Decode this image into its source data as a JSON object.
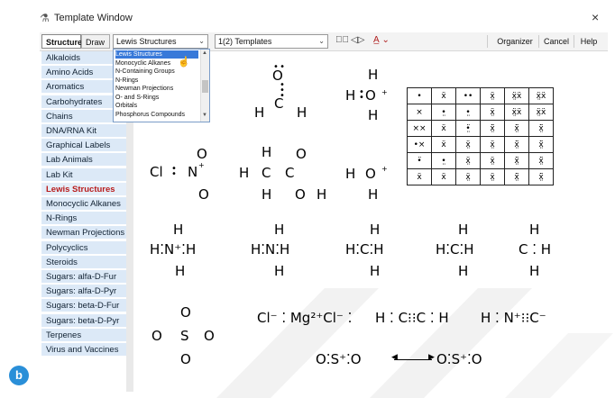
{
  "window": {
    "title": "Template Window",
    "close": "×"
  },
  "toolbar": {
    "tab_structure": "Structure",
    "tab_draw": "Draw",
    "category_select": "Lewis Structures",
    "template_select": "1(2) Templates",
    "organizer": "Organizer",
    "cancel": "Cancel",
    "help": "Help"
  },
  "dropdown": {
    "items": [
      "Lewis Structures",
      "Monocyclic Alkanes",
      "N-Containing Groups",
      "N-Rings",
      "Newman Projections",
      "O- and S-Rings",
      "Orbitals",
      "Phosphorus Compounds"
    ],
    "highlighted_index": 0
  },
  "sidebar": {
    "items": [
      "Alkaloids",
      "Amino Acids",
      "Aromatics",
      "Carbohydrates",
      "Chains",
      "DNA/RNA Kit",
      "Graphical Labels",
      "Lab Animals",
      "Lab Kit",
      "Lewis Structures",
      "Monocyclic Alkanes",
      "N-Rings",
      "Newman Projections",
      "Polycyclics",
      "Steroids",
      "Sugars: alfa-D-Fur",
      "Sugars: alfa-D-Pyr",
      "Sugars: beta-D-Fur",
      "Sugars: beta-D-Pyr",
      "Terpenes",
      "Virus and Vaccines"
    ],
    "selected_index": 9
  },
  "canvas": {
    "labels": {
      "water_o": "O",
      "water_h1": "H",
      "water_c": "C",
      "water_h2": "H",
      "hydronium_h": "H",
      "hydronium_left": "H",
      "hydronium_o": "O",
      "hydronium_plus": "+",
      "hydronium_bottom": "H",
      "nitrate_cl": "Cl",
      "nitrate_n": "N",
      "nitrate_plus": "+",
      "nitrate_o1": "O",
      "nitrate_o2": "O",
      "acid_h1": "H",
      "acid_h2": "H",
      "acid_c1": "C",
      "acid_c2": "C",
      "acid_o1": "O",
      "acid_o2": "O",
      "acid_h3": "H",
      "acid_h4": "H",
      "hyd2_left": "H",
      "hyd2_o": "O",
      "hyd2_plus": "+",
      "hyd2_bottom": "H",
      "ammonium": "H⁚N⁺⁚H",
      "methane_n": "H⁚N⁚H",
      "methane_c": "H⁚C⁚H",
      "methyl_c": "H⁚C⁚H",
      "radical_c": "C",
      "sulfate_s": "S",
      "mgcl2": "Cl⁻ ⁚ Mg²⁺Cl⁻ ⁚",
      "acetylene": "H ⁚ C⁝⁝C ⁚ H",
      "hcn": "H ⁚ N⁺⁝⁝C⁻",
      "so2_left": "O⁚S⁺⁚O",
      "so2_right": "O⁚S⁺⁚O"
    },
    "dot_table": [
      [
        "•",
        "ẍ",
        "••",
        "ẍ̤",
        "ẍ̤ẍ",
        "ẍ̤ẍ"
      ],
      [
        "×",
        "•̤",
        "•̤",
        "ẍ̤",
        "ẍ̤ẍ",
        "ẍ̤ẍ"
      ],
      [
        "××",
        "ẍ",
        "•̤̈",
        "ẍ̤̈",
        "ẍ̤̈",
        "ẍ̤̈"
      ],
      [
        "•×",
        "ẍ",
        "ẍ̤",
        "ẍ̤",
        "ẍ̤̈",
        "ẍ̤̈"
      ],
      [
        "•̈",
        "•̤",
        "ẍ̤",
        "ẍ̤",
        "ẍ̤̈",
        "ẍ̤̈"
      ],
      [
        "ẍ",
        "ẍ",
        "ẍ̤",
        "ẍ̤",
        "ẍ̤̈",
        "ẍ̤̈"
      ]
    ]
  },
  "badge": "b"
}
